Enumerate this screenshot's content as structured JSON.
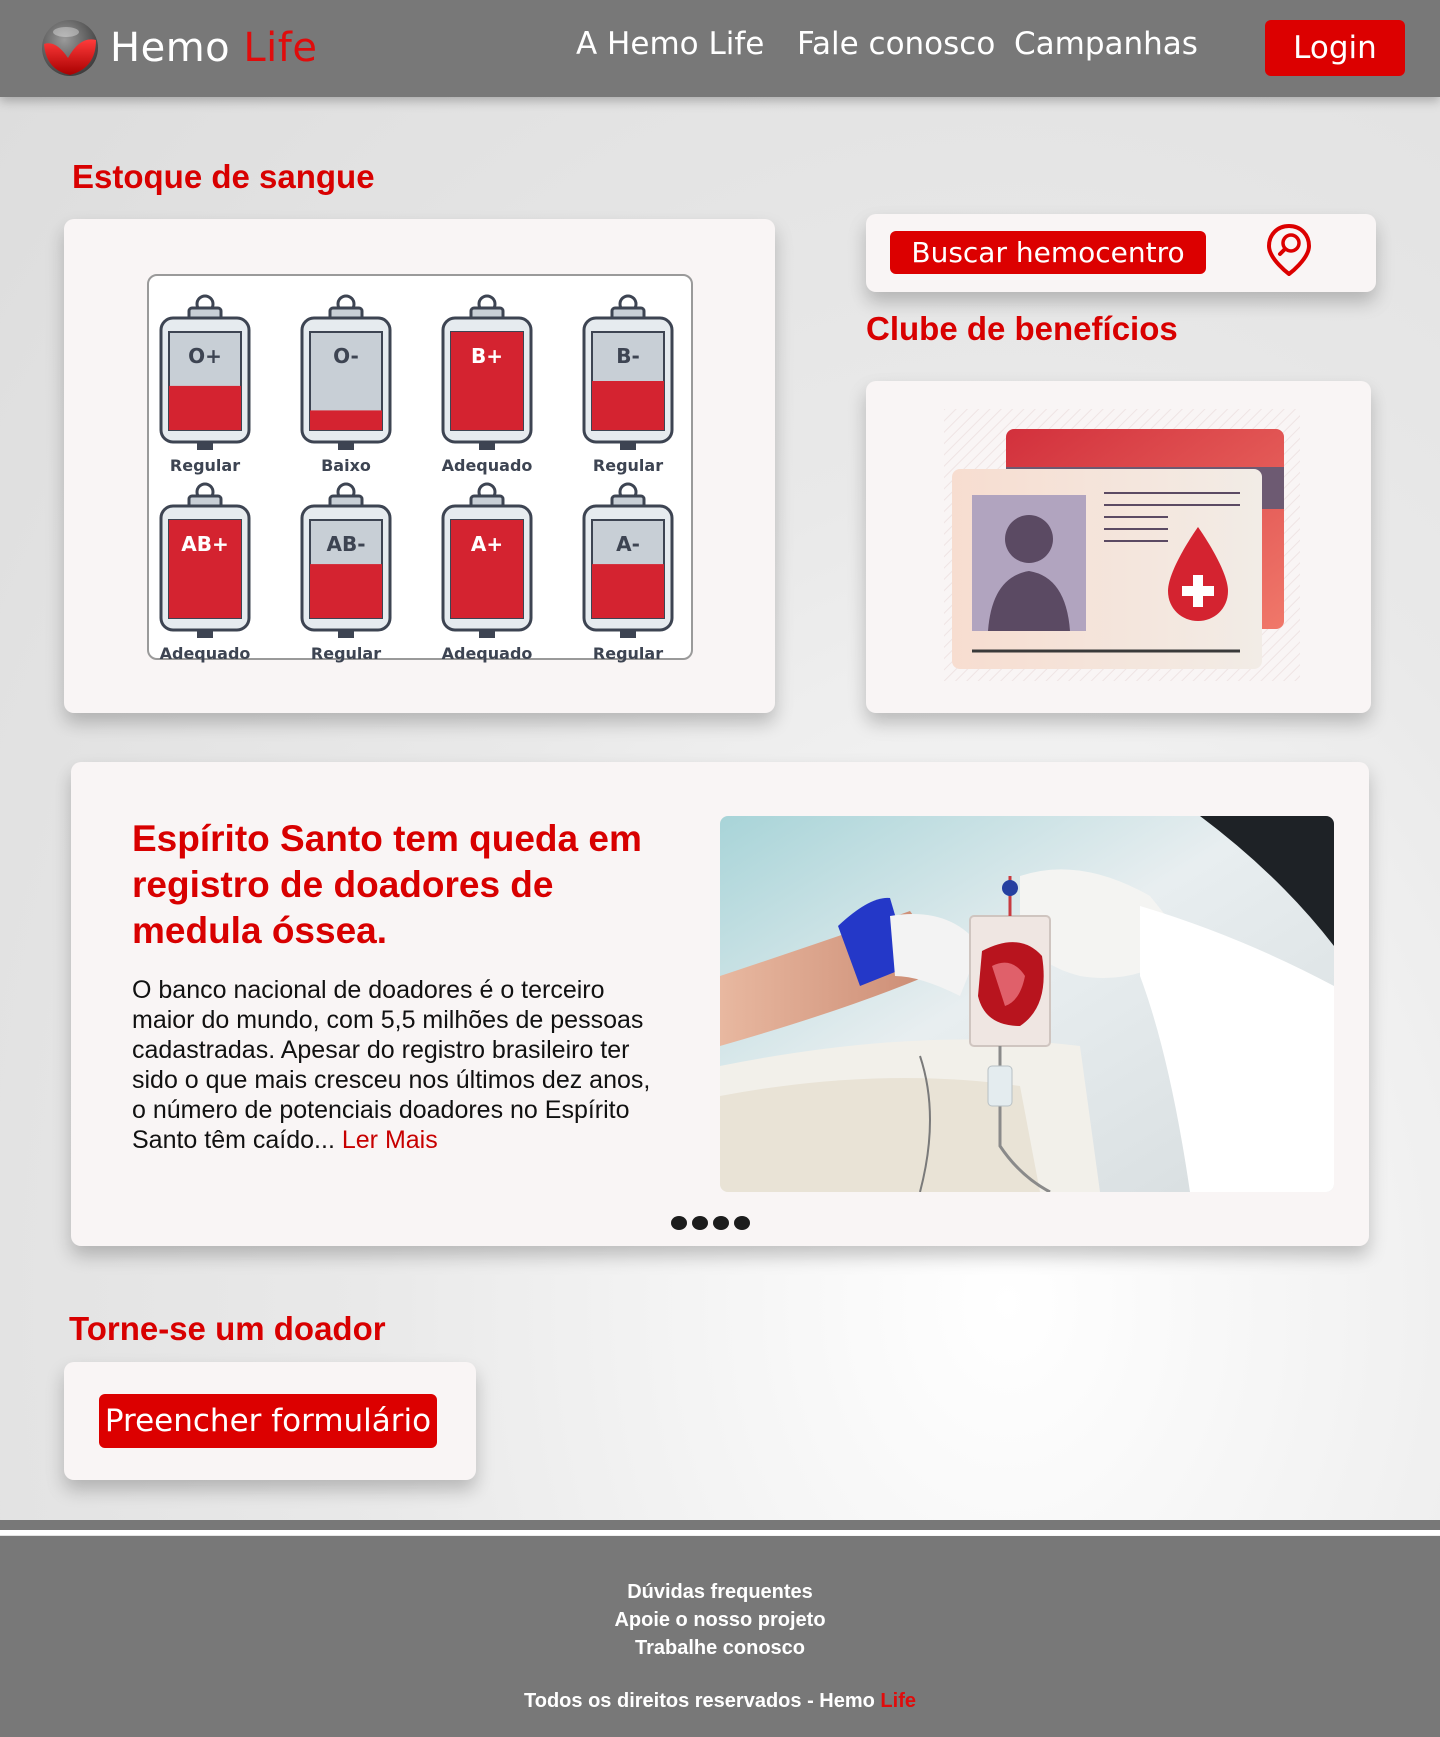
{
  "header": {
    "brand_main": "Hemo",
    "brand_accent": "Life",
    "nav": [
      "A Hemo Life",
      "Fale conosco",
      "Campanhas"
    ],
    "login_label": "Login"
  },
  "stock": {
    "title": "Estoque de sangue",
    "bags": [
      {
        "type": "O+",
        "status": "Regular",
        "level": 0.45
      },
      {
        "type": "O-",
        "status": "Baixo",
        "level": 0.2
      },
      {
        "type": "B+",
        "status": "Adequado",
        "level": 1.0
      },
      {
        "type": "B-",
        "status": "Regular",
        "level": 0.5
      },
      {
        "type": "AB+",
        "status": "Adequado",
        "level": 1.0
      },
      {
        "type": "AB-",
        "status": "Regular",
        "level": 0.55
      },
      {
        "type": "A+",
        "status": "Adequado",
        "level": 1.0
      },
      {
        "type": "A-",
        "status": "Regular",
        "level": 0.55
      }
    ],
    "colors": {
      "blood": "#d42330",
      "empty": "#c8cfd6",
      "outline": "#3d4452"
    }
  },
  "search": {
    "button_label": "Buscar hemocentro",
    "icon": "map-pin-search-icon"
  },
  "benefits": {
    "title": "Clube de benefícios",
    "illustration": "donor-card-icon"
  },
  "news": {
    "title": "Espírito Santo tem queda em registro de doadores de medula óssea.",
    "body": "O banco nacional de doadores é o terceiro maior do mundo, com 5,5 milhões de pessoas cadastradas. Apesar do registro brasileiro ter sido o que mais cresceu nos últimos dez anos, o número de potenciais doadores no Espírito Santo têm caído...",
    "read_more": "Ler Mais",
    "carousel_dots": 4
  },
  "donor": {
    "title": "Torne-se um doador",
    "button_label": "Preencher formulário"
  },
  "footer": {
    "links": [
      "Dúvidas frequentes",
      "Apoie o nosso projeto",
      "Trabalhe conosco"
    ],
    "copyright_prefix": "Todos os direitos reservados - Hemo",
    "copyright_accent": "Life"
  },
  "colors": {
    "accent": "#dc0000",
    "header_bg": "#787878",
    "card_bg": "#f9f5f5"
  }
}
